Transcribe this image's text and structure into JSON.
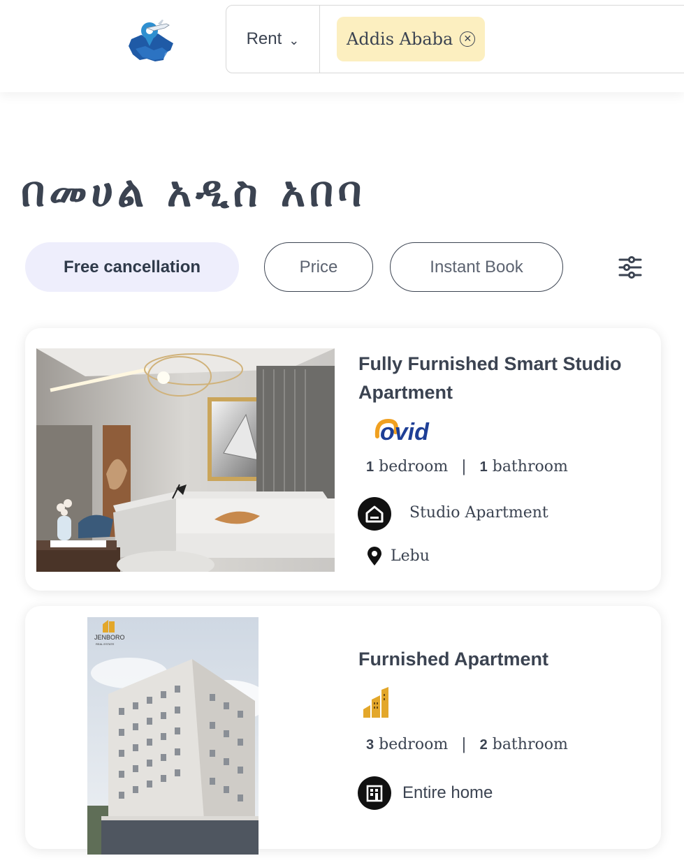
{
  "header": {
    "logo": "ethiopia-map-plane-logo",
    "listing_mode": "Rent",
    "location_chip": "Addis Ababa"
  },
  "page": {
    "heading": "በመሀል አዲስ አበባ"
  },
  "filters": {
    "items": [
      {
        "label": "Free cancellation",
        "active": true
      },
      {
        "label": "Price",
        "active": false
      },
      {
        "label": "Instant Book",
        "active": false
      }
    ],
    "more_icon": "sliders-icon"
  },
  "listings": [
    {
      "title": "Fully Furnished Smart Studio Apartment",
      "brand_logo": "ovid-logo",
      "brand_text": "ovid",
      "bedrooms": "1",
      "bedroom_label": "bedroom",
      "bathrooms": "1",
      "bathroom_label": "bathroom",
      "property_type": "Studio Apartment",
      "property_icon": "home-circle-icon",
      "location": "Lebu",
      "location_icon": "map-pin-icon"
    },
    {
      "title": "Furnished Apartment",
      "brand_logo": "jenboro-building-logo",
      "photo_brand_text": "JENBORO",
      "photo_brand_sub": "REAL ESTATE",
      "bedrooms": "3",
      "bedroom_label": "bedroom",
      "bathrooms": "2",
      "bathroom_label": "bathroom",
      "property_type": "Entire home",
      "property_icon": "building-circle-icon"
    }
  ],
  "colors": {
    "text": "#3b4351",
    "chip_bg": "#fcefc0",
    "active_filter_bg": "#eeeefc",
    "ovid_blue": "#1e3f96",
    "ovid_orange": "#f0a020",
    "jenboro_gold": "#e3a72a"
  }
}
